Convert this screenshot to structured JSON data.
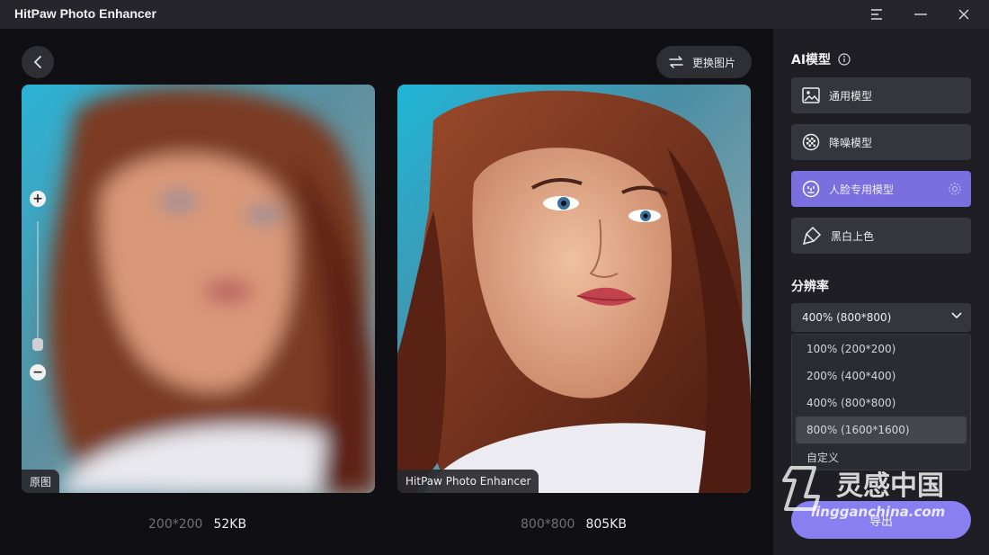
{
  "window": {
    "title": "HitPaw Photo Enhancer"
  },
  "toolbar": {
    "change_image_label": "更换图片"
  },
  "original_panel": {
    "tag": "原图",
    "dimensions": "200*200",
    "file_size": "52KB"
  },
  "enhanced_panel": {
    "tag": "HitPaw Photo Enhancer",
    "dimensions": "800*800",
    "file_size": "805KB"
  },
  "sidebar": {
    "ai_model_title": "AI模型",
    "models": [
      {
        "label": "通用模型",
        "icon": "image-icon",
        "active": false
      },
      {
        "label": "降噪模型",
        "icon": "noise-icon",
        "active": false
      },
      {
        "label": "人脸专用模型",
        "icon": "face-icon",
        "active": true
      },
      {
        "label": "黑白上色",
        "icon": "colorize-icon",
        "active": false
      }
    ],
    "resolution_title": "分辨率",
    "resolution_selected": "400% (800*800)",
    "resolution_options": [
      "100% (200*200)",
      "200% (400*400)",
      "400% (800*800)",
      "800% (1600*1600)",
      "自定义"
    ],
    "hovered_option": 3,
    "export_label": "导出"
  },
  "watermark": {
    "cn": "灵感中国",
    "en": "lingganchina.com"
  },
  "colors": {
    "accent": "#7b6fe0",
    "export": "#8a7ff0",
    "sidebar_bg": "#1e1e24",
    "main_bg": "#101014"
  }
}
